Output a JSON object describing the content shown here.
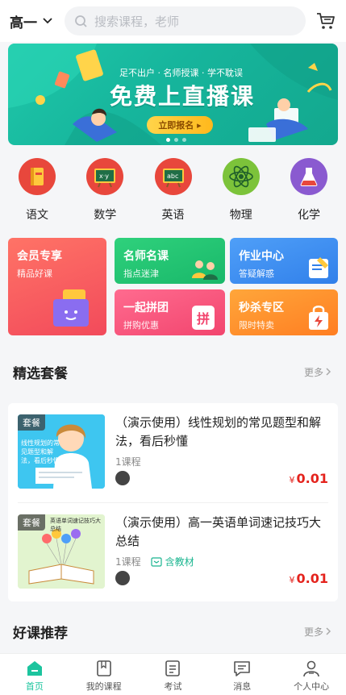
{
  "header": {
    "grade": "高一",
    "search_placeholder": "搜索课程，老师"
  },
  "banner": {
    "slogan": "足不出户 · 名师授课 · 学不耽误",
    "title": "免费上直播课",
    "button": "立即报名 ▸"
  },
  "subjects": [
    {
      "label": "语文",
      "icon": "book-icon",
      "color": "#e8473c"
    },
    {
      "label": "数学",
      "icon": "chalkboard-xy-icon",
      "color": "#e8473c"
    },
    {
      "label": "英语",
      "icon": "chalkboard-abc-icon",
      "color": "#e8473c"
    },
    {
      "label": "物理",
      "icon": "atom-icon",
      "color": "#7cc33a"
    },
    {
      "label": "化学",
      "icon": "flask-icon",
      "color": "#8a5ad0"
    }
  ],
  "features": {
    "vip": {
      "title": "会员专享",
      "sub": "精品好课"
    },
    "teacher": {
      "title": "名师名课",
      "sub": "指点迷津"
    },
    "homework": {
      "title": "作业中心",
      "sub": "答疑解惑"
    },
    "group": {
      "title": "一起拼团",
      "sub": "拼购优惠",
      "badge": "拼"
    },
    "flash": {
      "title": "秒杀专区",
      "sub": "限时特卖"
    }
  },
  "sections": {
    "selected": {
      "title": "精选套餐",
      "more": "更多"
    },
    "recommend": {
      "title": "好课推荐",
      "more": "更多"
    }
  },
  "courses": [
    {
      "tag": "套餐",
      "title": "（演示使用）线性规划的常见题型和解法，看后秒懂",
      "count": "1课程",
      "currency": "¥",
      "price": "0.01",
      "thumb_text": "线性规划的常见题型和解法，看后秒懂"
    },
    {
      "tag": "套餐",
      "title": "（演示使用）高一英语单词速记技巧大总结",
      "count": "1课程",
      "material": "含教材",
      "currency": "¥",
      "price": "0.01",
      "thumb_text": "英语单词速记技巧大总结"
    }
  ],
  "tabs": [
    {
      "label": "首页",
      "icon": "home-icon",
      "active": true
    },
    {
      "label": "我的课程",
      "icon": "my-courses-icon"
    },
    {
      "label": "考试",
      "icon": "exam-icon"
    },
    {
      "label": "消息",
      "icon": "message-icon"
    },
    {
      "label": "个人中心",
      "icon": "profile-icon"
    }
  ],
  "colors": {
    "accent": "#1cc49e",
    "price": "#e4231d"
  }
}
